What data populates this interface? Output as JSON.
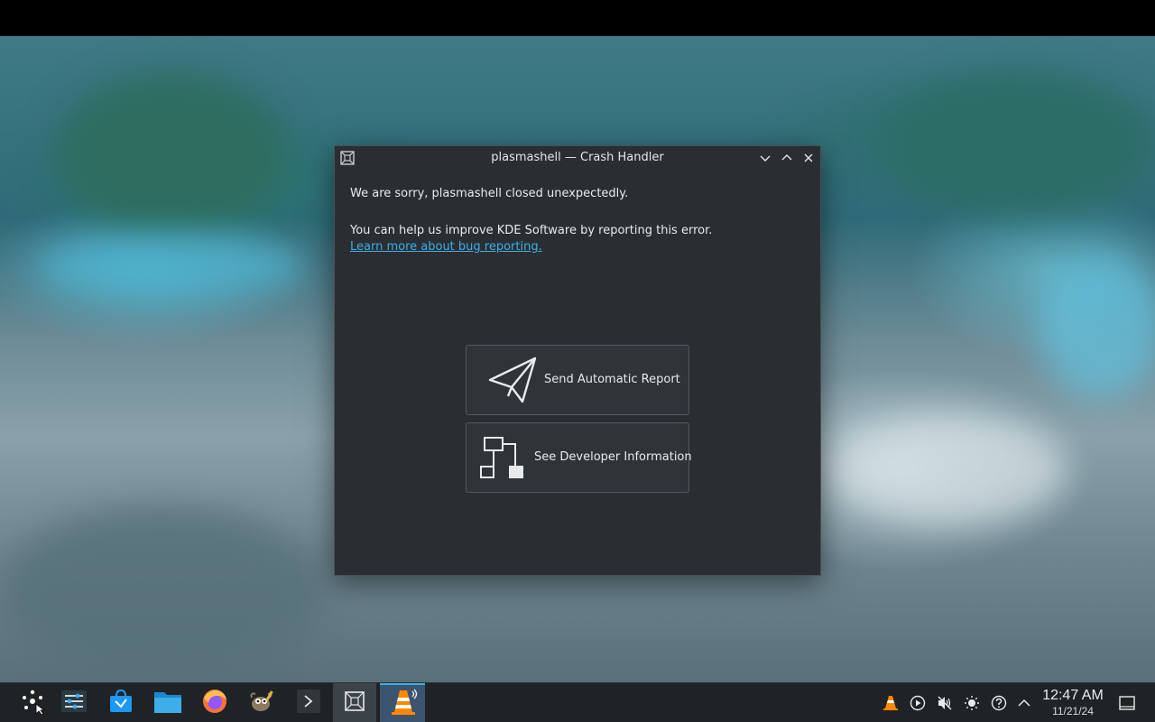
{
  "dialog": {
    "title": "plasmashell — Crash Handler",
    "message": "We are sorry, plasmashell closed unexpectedly.",
    "help_text": "You can help us improve KDE Software by reporting this error.",
    "link_text": "Learn more about bug reporting.",
    "buttons": [
      {
        "label": "Send Automatic Report",
        "icon": "paper-plane-icon"
      },
      {
        "label": "See Developer Information",
        "icon": "flowchart-icon"
      }
    ],
    "window_controls": [
      "minimize-icon",
      "maximize-icon",
      "close-icon"
    ]
  },
  "taskbar": {
    "launchers": [
      {
        "name": "application-launcher",
        "icon": "kde-launcher-icon"
      },
      {
        "name": "system-settings",
        "icon": "settings-sliders-icon"
      },
      {
        "name": "discover",
        "icon": "discover-store-icon"
      },
      {
        "name": "dolphin",
        "icon": "folder-icon"
      },
      {
        "name": "firefox",
        "icon": "firefox-icon"
      },
      {
        "name": "gimp",
        "icon": "gimp-icon"
      },
      {
        "name": "konsole",
        "icon": "terminal-icon"
      },
      {
        "name": "crash-handler",
        "icon": "crash-handler-icon"
      },
      {
        "name": "vlc",
        "icon": "vlc-cone-icon"
      }
    ],
    "tray": [
      "vlc-tray-icon",
      "media-play-icon",
      "volume-muted-icon",
      "brightness-icon",
      "help-icon",
      "chevron-up-icon"
    ],
    "clock": {
      "time": "12:47 AM",
      "date": "11/21/24"
    },
    "show_desktop_icon": "show-desktop-icon"
  },
  "colors": {
    "accent": "#3daee9",
    "dialog_bg": "#2a2e32",
    "taskbar_bg": "#1f2326"
  }
}
